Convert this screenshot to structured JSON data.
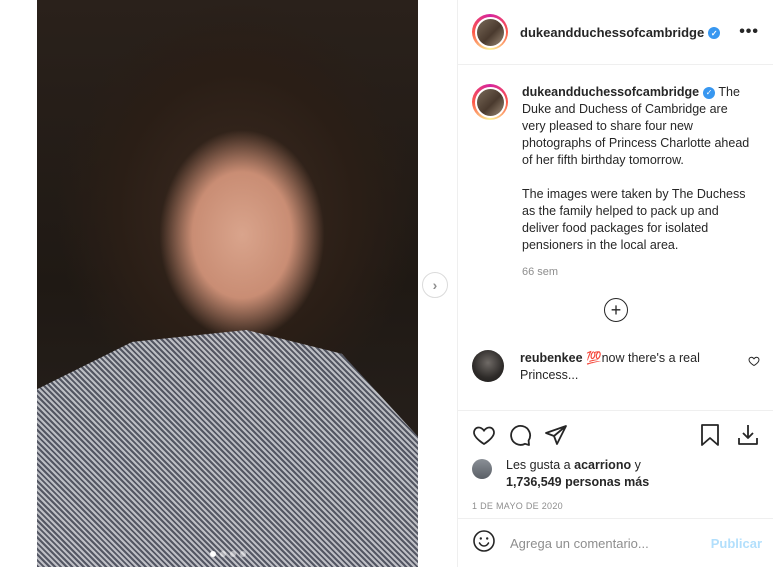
{
  "post": {
    "username": "dukeandduchessofcambridge",
    "verified_badge": "✓",
    "more_icon": "•••"
  },
  "caption": {
    "username": "dukeandduchessofcambridge",
    "paragraph1": "The Duke and Duchess of Cambridge are very pleased to share four new photographs of Princess Charlotte ahead of her fifth birthday tomorrow.",
    "paragraph2": "The images were taken by The Duchess as the family helped to pack up and deliver food packages for isolated pensioners in the local area.",
    "time_ago": "66 sem"
  },
  "load_more_icon": "+",
  "comment": {
    "username": "reubenkee",
    "text": "now there's a real Princess...",
    "emoji": "💯"
  },
  "likes": {
    "prefix": "Les gusta a",
    "user": "acarriono",
    "connector": "y",
    "count": "1,736,549 personas más"
  },
  "date": "1 DE MAYO DE 2020",
  "comment_box": {
    "placeholder": "Agrega un comentario...",
    "post_label": "Publicar"
  },
  "navigation": {
    "next_icon": "›"
  },
  "colors": {
    "verified": "#3897f0",
    "post_button_disabled": "#b2dffc",
    "muted_text": "#8e8e8e"
  }
}
